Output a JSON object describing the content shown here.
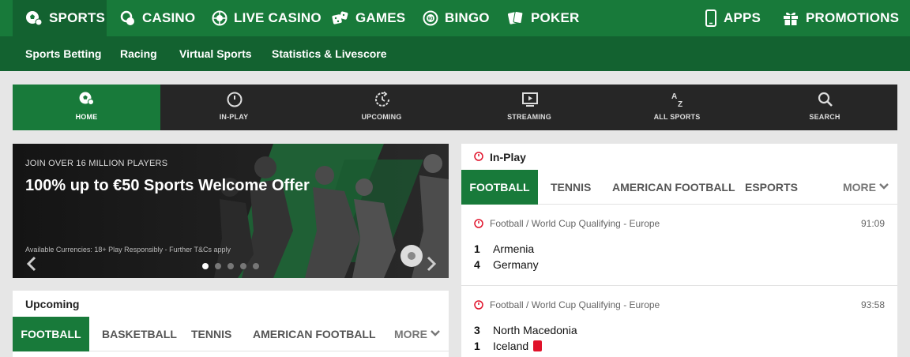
{
  "top_nav": {
    "items": [
      {
        "label": "SPORTS",
        "icon": "soccer-ball-icon",
        "active": true
      },
      {
        "label": "CASINO",
        "icon": "chips-icon"
      },
      {
        "label": "LIVE CASINO",
        "icon": "roulette-icon"
      },
      {
        "label": "GAMES",
        "icon": "dice-icon"
      },
      {
        "label": "BINGO",
        "icon": "bingo-ball-icon"
      },
      {
        "label": "POKER",
        "icon": "cards-icon"
      },
      {
        "label": "APPS",
        "icon": "phone-icon"
      },
      {
        "label": "PROMOTIONS",
        "icon": "gift-icon"
      }
    ]
  },
  "sub_nav": {
    "items": [
      "Sports Betting",
      "Racing",
      "Virtual Sports",
      "Statistics & Livescore"
    ]
  },
  "section_nav": {
    "items": [
      {
        "label": "HOME",
        "icon": "soccer-ball-icon",
        "active": true
      },
      {
        "label": "IN-PLAY",
        "icon": "stopwatch-icon"
      },
      {
        "label": "UPCOMING",
        "icon": "refresh-clock-icon"
      },
      {
        "label": "STREAMING",
        "icon": "monitor-play-icon"
      },
      {
        "label": "ALL SPORTS",
        "icon": "a-z-icon"
      },
      {
        "label": "SEARCH",
        "icon": "search-icon"
      }
    ]
  },
  "banner": {
    "kicker": "JOIN OVER 16 MILLION PLAYERS",
    "headline": "100% up to €50 Sports Welcome Offer",
    "terms": "Available Currencies: 18+ Play Responsibly - Further T&Cs apply",
    "slide_count": 5,
    "active_slide": 1
  },
  "upcoming": {
    "title": "Upcoming",
    "tabs": [
      "FOOTBALL",
      "BASKETBALL",
      "TENNIS",
      "AMERICAN FOOTBALL"
    ],
    "active_tab": 0,
    "more_label": "MORE"
  },
  "inplay": {
    "title": "In-Play",
    "tabs": [
      "FOOTBALL",
      "TENNIS",
      "AMERICAN FOOTBALL",
      "ESPORTS"
    ],
    "active_tab": 0,
    "more_label": "MORE",
    "matches": [
      {
        "league": "Football / World Cup Qualifying - Europe",
        "time": "91:09",
        "teams": [
          {
            "score": "1",
            "name": "Armenia",
            "red_card": false
          },
          {
            "score": "4",
            "name": "Germany",
            "red_card": false
          }
        ]
      },
      {
        "league": "Football / World Cup Qualifying - Europe",
        "time": "93:58",
        "teams": [
          {
            "score": "3",
            "name": "North Macedonia",
            "red_card": false
          },
          {
            "score": "1",
            "name": "Iceland",
            "red_card": true
          }
        ]
      }
    ]
  },
  "colors": {
    "brand_green": "#187a3a",
    "dark_green": "#136230",
    "section_bar": "#262626",
    "clock_red": "#e0122a"
  }
}
